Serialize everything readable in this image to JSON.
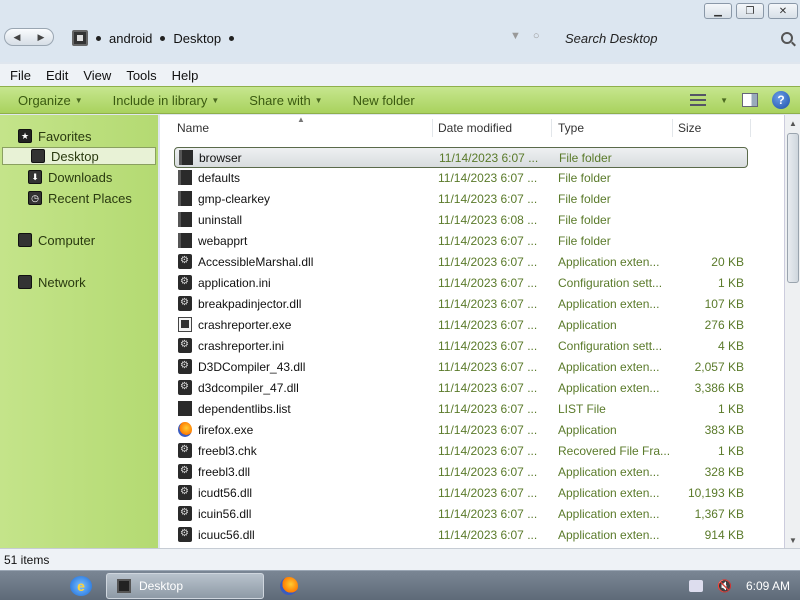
{
  "breadcrumb": {
    "items": [
      "android",
      "Desktop"
    ]
  },
  "search": {
    "placeholder": "Search Desktop"
  },
  "menu": [
    "File",
    "Edit",
    "View",
    "Tools",
    "Help"
  ],
  "toolbar": {
    "organize": "Organize",
    "include": "Include in library",
    "share": "Share with",
    "new_folder": "New folder"
  },
  "nav": {
    "favorites": "Favorites",
    "desktop": "Desktop",
    "downloads": "Downloads",
    "recent": "Recent Places",
    "computer": "Computer",
    "network": "Network"
  },
  "columns": {
    "name": "Name",
    "date": "Date modified",
    "type": "Type",
    "size": "Size"
  },
  "files": [
    {
      "name": "browser",
      "date": "11/14/2023 6:07 ...",
      "type": "File folder",
      "size": "",
      "icon": "folder-icon"
    },
    {
      "name": "defaults",
      "date": "11/14/2023 6:07 ...",
      "type": "File folder",
      "size": "",
      "icon": "folder-icon"
    },
    {
      "name": "gmp-clearkey",
      "date": "11/14/2023 6:07 ...",
      "type": "File folder",
      "size": "",
      "icon": "folder-icon"
    },
    {
      "name": "uninstall",
      "date": "11/14/2023 6:08 ...",
      "type": "File folder",
      "size": "",
      "icon": "folder-icon"
    },
    {
      "name": "webapprt",
      "date": "11/14/2023 6:07 ...",
      "type": "File folder",
      "size": "",
      "icon": "folder-icon"
    },
    {
      "name": "AccessibleMarshal.dll",
      "date": "11/14/2023 6:07 ...",
      "type": "Application exten...",
      "size": "20 KB",
      "icon": "dll-icon"
    },
    {
      "name": "application.ini",
      "date": "11/14/2023 6:07 ...",
      "type": "Configuration sett...",
      "size": "1 KB",
      "icon": "dll-icon"
    },
    {
      "name": "breakpadinjector.dll",
      "date": "11/14/2023 6:07 ...",
      "type": "Application exten...",
      "size": "107 KB",
      "icon": "dll-icon"
    },
    {
      "name": "crashreporter.exe",
      "date": "11/14/2023 6:07 ...",
      "type": "Application",
      "size": "276 KB",
      "icon": "exe-icon"
    },
    {
      "name": "crashreporter.ini",
      "date": "11/14/2023 6:07 ...",
      "type": "Configuration sett...",
      "size": "4 KB",
      "icon": "dll-icon"
    },
    {
      "name": "D3DCompiler_43.dll",
      "date": "11/14/2023 6:07 ...",
      "type": "Application exten...",
      "size": "2,057 KB",
      "icon": "dll-icon"
    },
    {
      "name": "d3dcompiler_47.dll",
      "date": "11/14/2023 6:07 ...",
      "type": "Application exten...",
      "size": "3,386 KB",
      "icon": "dll-icon"
    },
    {
      "name": "dependentlibs.list",
      "date": "11/14/2023 6:07 ...",
      "type": "LIST File",
      "size": "1 KB",
      "icon": "list-icon"
    },
    {
      "name": "firefox.exe",
      "date": "11/14/2023 6:07 ...",
      "type": "Application",
      "size": "383 KB",
      "icon": "firefox-icon"
    },
    {
      "name": "freebl3.chk",
      "date": "11/14/2023 6:07 ...",
      "type": "Recovered File Fra...",
      "size": "1 KB",
      "icon": "dll-icon"
    },
    {
      "name": "freebl3.dll",
      "date": "11/14/2023 6:07 ...",
      "type": "Application exten...",
      "size": "328 KB",
      "icon": "dll-icon"
    },
    {
      "name": "icudt56.dll",
      "date": "11/14/2023 6:07 ...",
      "type": "Application exten...",
      "size": "10,193 KB",
      "icon": "dll-icon"
    },
    {
      "name": "icuin56.dll",
      "date": "11/14/2023 6:07 ...",
      "type": "Application exten...",
      "size": "1,367 KB",
      "icon": "dll-icon"
    },
    {
      "name": "icuuc56.dll",
      "date": "11/14/2023 6:07 ...",
      "type": "Application exten...",
      "size": "914 KB",
      "icon": "dll-icon"
    }
  ],
  "status": {
    "count": "51 items"
  },
  "taskbar": {
    "task_label": "Desktop",
    "clock": "6:09 AM"
  }
}
